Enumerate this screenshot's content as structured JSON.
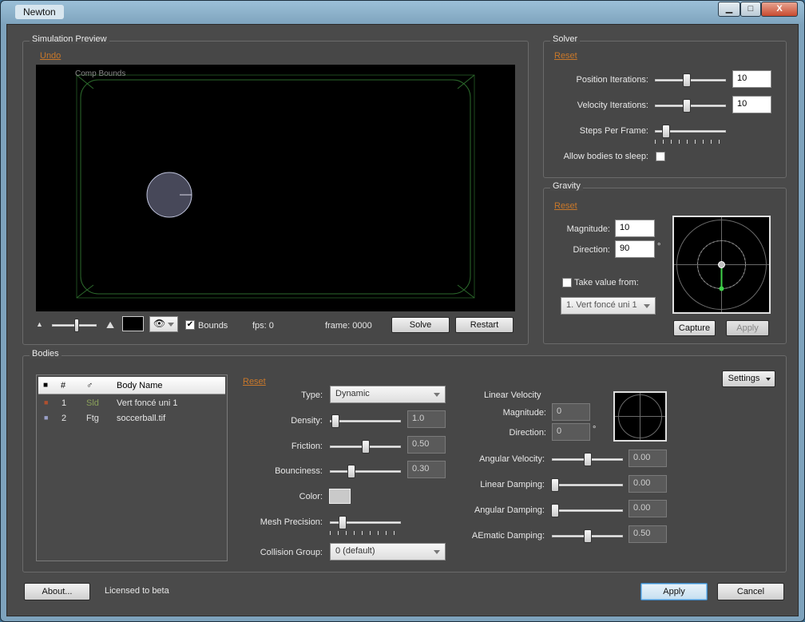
{
  "window": {
    "title": "Newton",
    "min_glyph": "▁",
    "max_glyph": "□",
    "close_glyph": "X"
  },
  "preview": {
    "title": "Simulation Preview",
    "undo_label": "Undo",
    "comp_label": "Comp Bounds",
    "bounds_label": "Bounds",
    "bounds_checked": true,
    "fps": "fps: 0",
    "frame": "frame: 0000",
    "solve_label": "Solve",
    "restart_label": "Restart",
    "zoom_fraction": 0.55
  },
  "solver": {
    "title": "Solver",
    "reset_label": "Reset",
    "position_label": "Position Iterations:",
    "position_value": "10",
    "position_fraction": 0.45,
    "velocity_label": "Velocity Iterations:",
    "velocity_value": "10",
    "velocity_fraction": 0.45,
    "steps_label": "Steps Per Frame:",
    "steps_fraction": 0.16,
    "sleep_label": "Allow bodies to sleep:",
    "sleep_checked": false
  },
  "gravity": {
    "title": "Gravity",
    "reset_label": "Reset",
    "magnitude_label": "Magnitude:",
    "magnitude_value": "10",
    "direction_label": "Direction:",
    "direction_value": "90",
    "degree": "°",
    "take_label": "Take value from:",
    "take_checked": false,
    "source_value": "1. Vert foncé uni 1",
    "capture_label": "Capture",
    "apply_label": "Apply"
  },
  "bodies": {
    "title": "Bodies",
    "reset_label": "Reset",
    "settings_label": "Settings",
    "list": {
      "headers": {
        "color": "■",
        "num": "#",
        "type": "♂",
        "name": "Body Name"
      },
      "rows": [
        {
          "num": "1",
          "type": "Sld",
          "name": "Vert foncé uni 1",
          "color": "#b0502f",
          "type_color": "#8aa05a"
        },
        {
          "num": "2",
          "type": "Ftg",
          "name": "soccerball.tif",
          "color": "#9aa0c8",
          "type_color": "#e0e0e0"
        }
      ]
    },
    "type_label": "Type:",
    "type_value": "Dynamic",
    "density_label": "Density:",
    "density_value": "1.0",
    "density_fraction": 0.08,
    "friction_label": "Friction:",
    "friction_value": "0.50",
    "friction_fraction": 0.5,
    "bounciness_label": "Bounciness:",
    "bounciness_value": "0.30",
    "bounciness_fraction": 0.3,
    "color_label": "Color:",
    "mesh_label": "Mesh Precision:",
    "mesh_fraction": 0.18,
    "collision_label": "Collision Group:",
    "collision_value": "0 (default)",
    "linear_velocity_label": "Linear Velocity",
    "lv_magnitude_label": "Magnitude:",
    "lv_magnitude_value": "0",
    "lv_direction_label": "Direction:",
    "lv_direction_value": "0",
    "degree": "°",
    "angular_velocity_label": "Angular Velocity:",
    "angular_velocity_value": "0.00",
    "angular_velocity_fraction": 0.5,
    "linear_damping_label": "Linear Damping:",
    "linear_damping_value": "0.00",
    "linear_damping_fraction": 0.0,
    "angular_damping_label": "Angular Damping:",
    "angular_damping_value": "0.00",
    "angular_damping_fraction": 0.0,
    "aematic_label": "AEmatic Damping:",
    "aematic_value": "0.50",
    "aematic_fraction": 0.5
  },
  "footer": {
    "about_label": "About...",
    "license_text": "Licensed to beta",
    "apply_label": "Apply",
    "cancel_label": "Cancel"
  }
}
